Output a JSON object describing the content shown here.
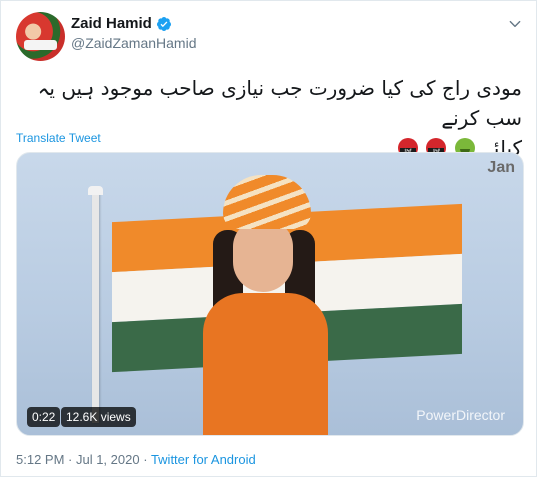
{
  "user": {
    "display_name": "Zaid Hamid",
    "handle": "@ZaidZamanHamid",
    "verified": true
  },
  "tweet": {
    "text_line1": "مودی راج کی کیا ضرورت جب نیازی صاحب موجود ہیں یہ سب کرنے",
    "text_line2": "کیلئے",
    "emojis": [
      "face-with-symbols-on-mouth",
      "face-with-symbols-on-mouth",
      "nauseated-face"
    ],
    "translate_label": "Translate Tweet"
  },
  "media": {
    "duration": "0:22",
    "views": "12.6K views",
    "logo_text": "Jan",
    "watermark": "PowerDirector"
  },
  "meta": {
    "timestamp": "5:12 PM · Jul 1, 2020",
    "separator": "·",
    "source": "Twitter for Android"
  },
  "colors": {
    "link": "#1b95e0",
    "verified": "#1da1f2",
    "secondary_text": "#657786"
  }
}
